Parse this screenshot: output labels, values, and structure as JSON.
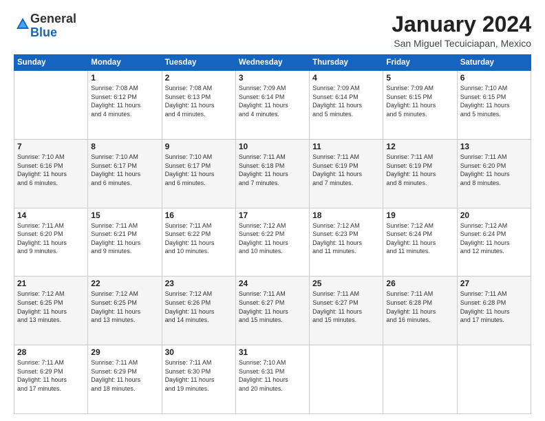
{
  "logo": {
    "general": "General",
    "blue": "Blue"
  },
  "header": {
    "month": "January 2024",
    "location": "San Miguel Tecuiciapan, Mexico"
  },
  "weekdays": [
    "Sunday",
    "Monday",
    "Tuesday",
    "Wednesday",
    "Thursday",
    "Friday",
    "Saturday"
  ],
  "weeks": [
    [
      {
        "day": "",
        "info": ""
      },
      {
        "day": "1",
        "info": "Sunrise: 7:08 AM\nSunset: 6:12 PM\nDaylight: 11 hours\nand 4 minutes."
      },
      {
        "day": "2",
        "info": "Sunrise: 7:08 AM\nSunset: 6:13 PM\nDaylight: 11 hours\nand 4 minutes."
      },
      {
        "day": "3",
        "info": "Sunrise: 7:09 AM\nSunset: 6:14 PM\nDaylight: 11 hours\nand 4 minutes."
      },
      {
        "day": "4",
        "info": "Sunrise: 7:09 AM\nSunset: 6:14 PM\nDaylight: 11 hours\nand 5 minutes."
      },
      {
        "day": "5",
        "info": "Sunrise: 7:09 AM\nSunset: 6:15 PM\nDaylight: 11 hours\nand 5 minutes."
      },
      {
        "day": "6",
        "info": "Sunrise: 7:10 AM\nSunset: 6:15 PM\nDaylight: 11 hours\nand 5 minutes."
      }
    ],
    [
      {
        "day": "7",
        "info": "Sunrise: 7:10 AM\nSunset: 6:16 PM\nDaylight: 11 hours\nand 6 minutes."
      },
      {
        "day": "8",
        "info": "Sunrise: 7:10 AM\nSunset: 6:17 PM\nDaylight: 11 hours\nand 6 minutes."
      },
      {
        "day": "9",
        "info": "Sunrise: 7:10 AM\nSunset: 6:17 PM\nDaylight: 11 hours\nand 6 minutes."
      },
      {
        "day": "10",
        "info": "Sunrise: 7:11 AM\nSunset: 6:18 PM\nDaylight: 11 hours\nand 7 minutes."
      },
      {
        "day": "11",
        "info": "Sunrise: 7:11 AM\nSunset: 6:19 PM\nDaylight: 11 hours\nand 7 minutes."
      },
      {
        "day": "12",
        "info": "Sunrise: 7:11 AM\nSunset: 6:19 PM\nDaylight: 11 hours\nand 8 minutes."
      },
      {
        "day": "13",
        "info": "Sunrise: 7:11 AM\nSunset: 6:20 PM\nDaylight: 11 hours\nand 8 minutes."
      }
    ],
    [
      {
        "day": "14",
        "info": "Sunrise: 7:11 AM\nSunset: 6:20 PM\nDaylight: 11 hours\nand 9 minutes."
      },
      {
        "day": "15",
        "info": "Sunrise: 7:11 AM\nSunset: 6:21 PM\nDaylight: 11 hours\nand 9 minutes."
      },
      {
        "day": "16",
        "info": "Sunrise: 7:11 AM\nSunset: 6:22 PM\nDaylight: 11 hours\nand 10 minutes."
      },
      {
        "day": "17",
        "info": "Sunrise: 7:12 AM\nSunset: 6:22 PM\nDaylight: 11 hours\nand 10 minutes."
      },
      {
        "day": "18",
        "info": "Sunrise: 7:12 AM\nSunset: 6:23 PM\nDaylight: 11 hours\nand 11 minutes."
      },
      {
        "day": "19",
        "info": "Sunrise: 7:12 AM\nSunset: 6:24 PM\nDaylight: 11 hours\nand 11 minutes."
      },
      {
        "day": "20",
        "info": "Sunrise: 7:12 AM\nSunset: 6:24 PM\nDaylight: 11 hours\nand 12 minutes."
      }
    ],
    [
      {
        "day": "21",
        "info": "Sunrise: 7:12 AM\nSunset: 6:25 PM\nDaylight: 11 hours\nand 13 minutes."
      },
      {
        "day": "22",
        "info": "Sunrise: 7:12 AM\nSunset: 6:25 PM\nDaylight: 11 hours\nand 13 minutes."
      },
      {
        "day": "23",
        "info": "Sunrise: 7:12 AM\nSunset: 6:26 PM\nDaylight: 11 hours\nand 14 minutes."
      },
      {
        "day": "24",
        "info": "Sunrise: 7:11 AM\nSunset: 6:27 PM\nDaylight: 11 hours\nand 15 minutes."
      },
      {
        "day": "25",
        "info": "Sunrise: 7:11 AM\nSunset: 6:27 PM\nDaylight: 11 hours\nand 15 minutes."
      },
      {
        "day": "26",
        "info": "Sunrise: 7:11 AM\nSunset: 6:28 PM\nDaylight: 11 hours\nand 16 minutes."
      },
      {
        "day": "27",
        "info": "Sunrise: 7:11 AM\nSunset: 6:28 PM\nDaylight: 11 hours\nand 17 minutes."
      }
    ],
    [
      {
        "day": "28",
        "info": "Sunrise: 7:11 AM\nSunset: 6:29 PM\nDaylight: 11 hours\nand 17 minutes."
      },
      {
        "day": "29",
        "info": "Sunrise: 7:11 AM\nSunset: 6:29 PM\nDaylight: 11 hours\nand 18 minutes."
      },
      {
        "day": "30",
        "info": "Sunrise: 7:11 AM\nSunset: 6:30 PM\nDaylight: 11 hours\nand 19 minutes."
      },
      {
        "day": "31",
        "info": "Sunrise: 7:10 AM\nSunset: 6:31 PM\nDaylight: 11 hours\nand 20 minutes."
      },
      {
        "day": "",
        "info": ""
      },
      {
        "day": "",
        "info": ""
      },
      {
        "day": "",
        "info": ""
      }
    ]
  ]
}
